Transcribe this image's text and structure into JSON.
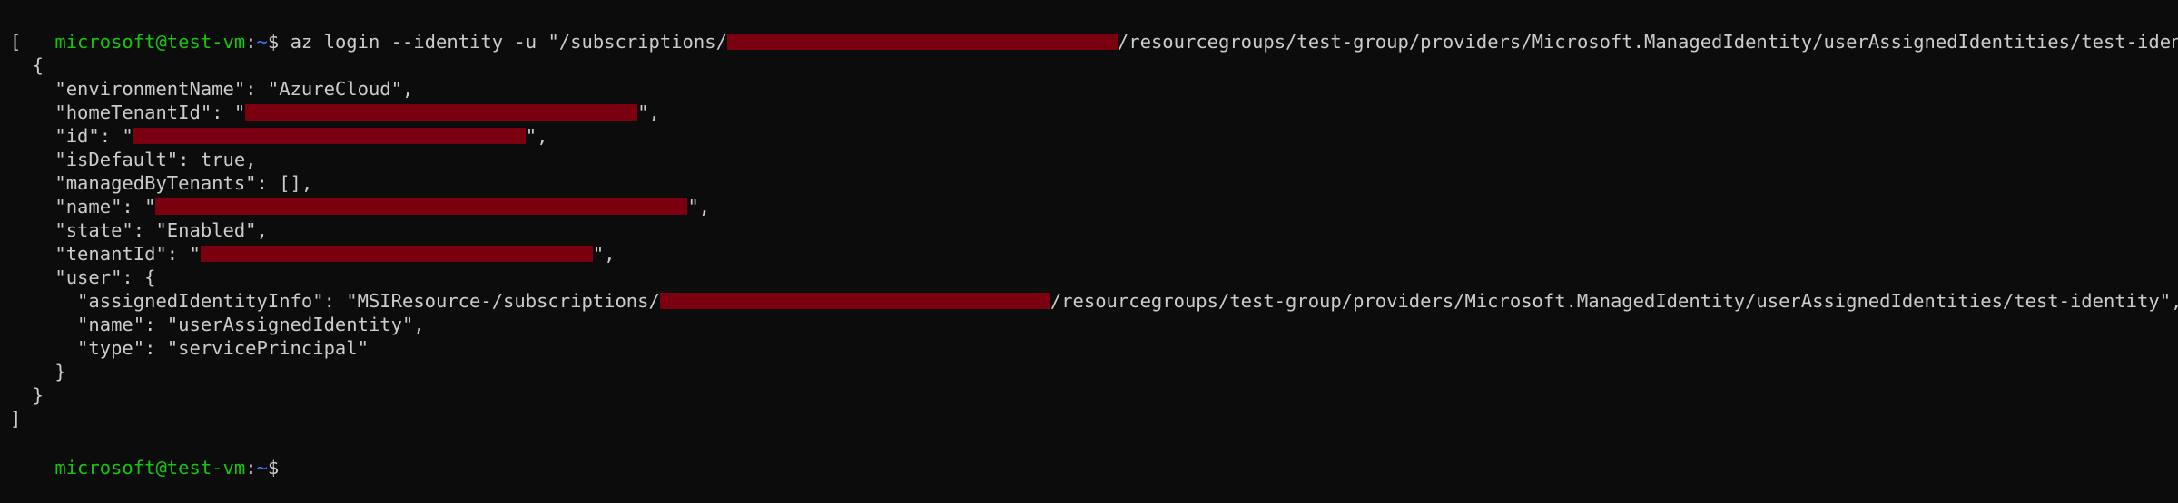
{
  "terminal": {
    "prompt_user_host": "microsoft@test-vm",
    "prompt_separator": ":",
    "prompt_path": "~",
    "prompt_sign": "$ ",
    "command_part1": "az login --identity -u \"/subscriptions/",
    "command_part2": "/resourcegroups/test-group/providers/Microsoft.ManagedIdentity/userAssignedIdentities/test-identity\"",
    "colors": {
      "background": "#0c0c0c",
      "text": "#cccccc",
      "prompt_user": "#16c60c",
      "prompt_path": "#3b78ff",
      "redaction": "#7a0010"
    }
  },
  "output": {
    "open_bracket": "[",
    "open_brace": "  {",
    "environment_name_line": "    \"environmentName\": \"AzureCloud\",",
    "home_tenant_prefix": "    \"homeTenantId\": \"",
    "home_tenant_suffix": "\",",
    "id_prefix": "    \"id\": \"",
    "id_suffix": "\",",
    "is_default_line": "    \"isDefault\": true,",
    "managed_by_tenants_line": "    \"managedByTenants\": [],",
    "name_prefix": "    \"name\": \"",
    "name_suffix": "\",",
    "state_line": "    \"state\": \"Enabled\",",
    "tenant_id_prefix": "    \"tenantId\": \"",
    "tenant_id_suffix": "\",",
    "user_open": "    \"user\": {",
    "assigned_identity_prefix": "      \"assignedIdentityInfo\": \"MSIResource-/subscriptions/",
    "assigned_identity_suffix": "/resourcegroups/test-group/providers/Microsoft.ManagedIdentity/userAssignedIdentities/test-identity\",",
    "user_name_line": "      \"name\": \"userAssignedIdentity\",",
    "user_type_line": "      \"type\": \"servicePrincipal\"",
    "user_close": "    }",
    "close_brace": "  }",
    "close_bracket": "]"
  }
}
